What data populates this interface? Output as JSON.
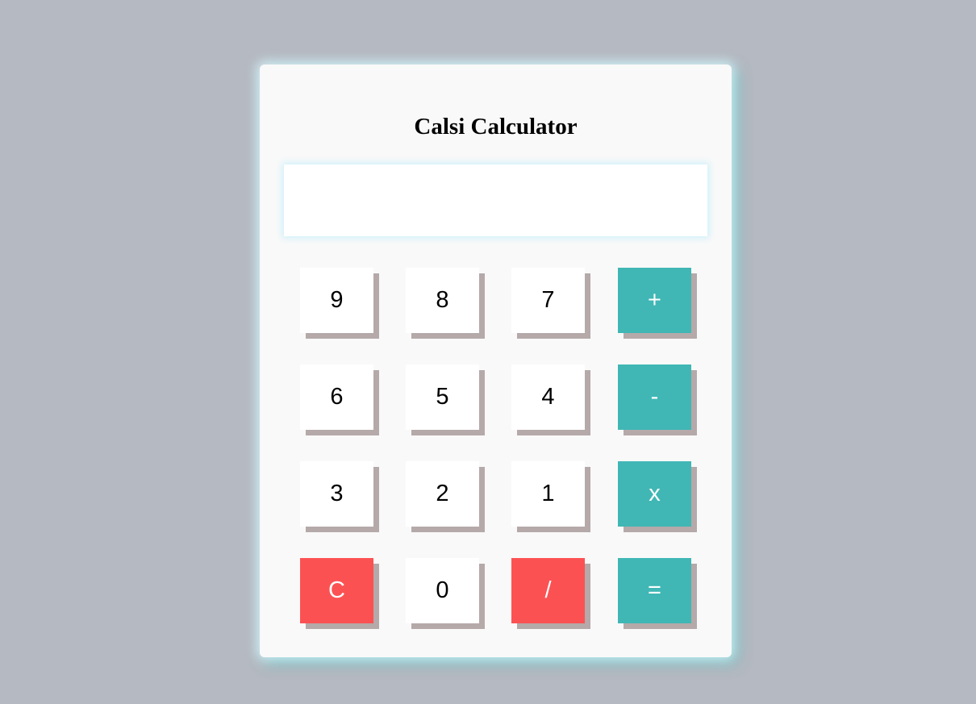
{
  "calculator": {
    "title": "Calsi Calculator",
    "display_value": "",
    "colors": {
      "page_background": "#b5b9c1",
      "panel": "#f9f9f9",
      "digit_button": "#ffffff",
      "operator_button": "#40b7b5",
      "danger_button": "#fc5153",
      "button_shadow": "#b5a9a9"
    },
    "keys": {
      "nine": "9",
      "eight": "8",
      "seven": "7",
      "plus": "+",
      "six": "6",
      "five": "5",
      "four": "4",
      "minus": "-",
      "three": "3",
      "two": "2",
      "one": "1",
      "multiply": "x",
      "clear": "C",
      "zero": "0",
      "divide": "/",
      "equals": "="
    }
  }
}
